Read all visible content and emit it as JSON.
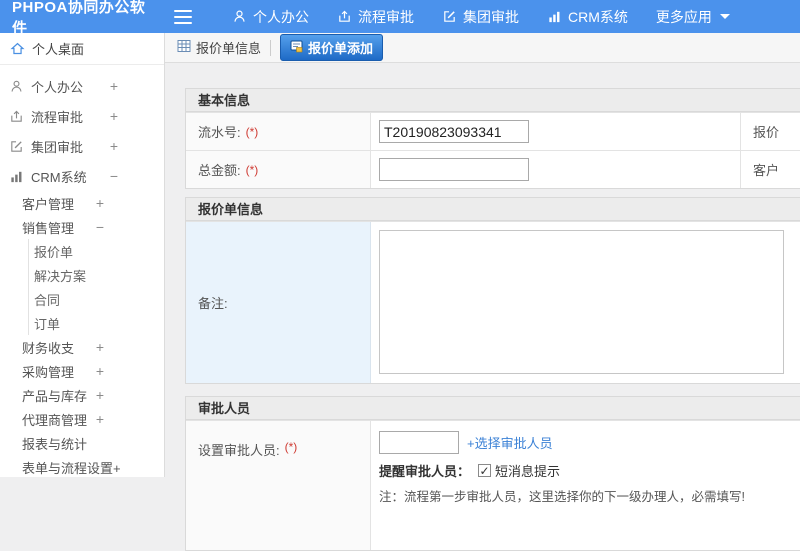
{
  "colors": {
    "topbar": "#4b92ec",
    "active_tab": "#2173cd",
    "link": "#3c82d6",
    "required": "#cf3b33",
    "remark_label_bg": "#e9f3fc"
  },
  "topbar": {
    "logo": "PHPOA协同办公软件",
    "items": [
      {
        "label": "个人办公",
        "icon": "user-icon"
      },
      {
        "label": "流程审批",
        "icon": "workflow-icon"
      },
      {
        "label": "集团审批",
        "icon": "edit-icon"
      },
      {
        "label": "CRM系统",
        "icon": "chart-icon"
      },
      {
        "label": "更多应用",
        "icon": "caret-down-icon"
      }
    ]
  },
  "sidebar": {
    "desktop": "个人桌面",
    "items": [
      {
        "label": "个人办公",
        "toggle": "+"
      },
      {
        "label": "流程审批",
        "toggle": "+"
      },
      {
        "label": "集团审批",
        "toggle": "+"
      },
      {
        "label": "CRM系统",
        "toggle": "−"
      },
      {
        "label": "客户管理",
        "toggle": "+"
      },
      {
        "label": "销售管理",
        "toggle": "−"
      },
      {
        "label": "报价单"
      },
      {
        "label": "解决方案"
      },
      {
        "label": "合同"
      },
      {
        "label": "订单"
      },
      {
        "label": "财务收支",
        "toggle": "+"
      },
      {
        "label": "采购管理",
        "toggle": "+"
      },
      {
        "label": "产品与库存",
        "toggle": "+"
      },
      {
        "label": "代理商管理",
        "toggle": "+"
      },
      {
        "label": "报表与统计"
      },
      {
        "label": "表单与流程设置+"
      }
    ]
  },
  "tabs": {
    "info": "报价单信息",
    "add": "报价单添加"
  },
  "form": {
    "basic": {
      "title": "基本信息",
      "rows": [
        {
          "label": "流水号:",
          "required": "(*)",
          "value": "T20190823093341",
          "right_label": "报价"
        },
        {
          "label": "总金额:",
          "required": "(*)",
          "value": "",
          "right_label": "客户"
        }
      ]
    },
    "quote": {
      "title": "报价单信息",
      "remark_label": "备注:",
      "remark_value": ""
    },
    "approver": {
      "title": "审批人员",
      "set_label": "设置审批人员:",
      "required": "(*)",
      "input_value": "",
      "choose_link": "+选择审批人员",
      "remind_label": "提醒审批人员：",
      "checkbox_checked": "✓",
      "sms_label": "短消息提示",
      "note": "注：流程第一步审批人员，这里选择你的下一级办理人，必需填写!"
    }
  }
}
